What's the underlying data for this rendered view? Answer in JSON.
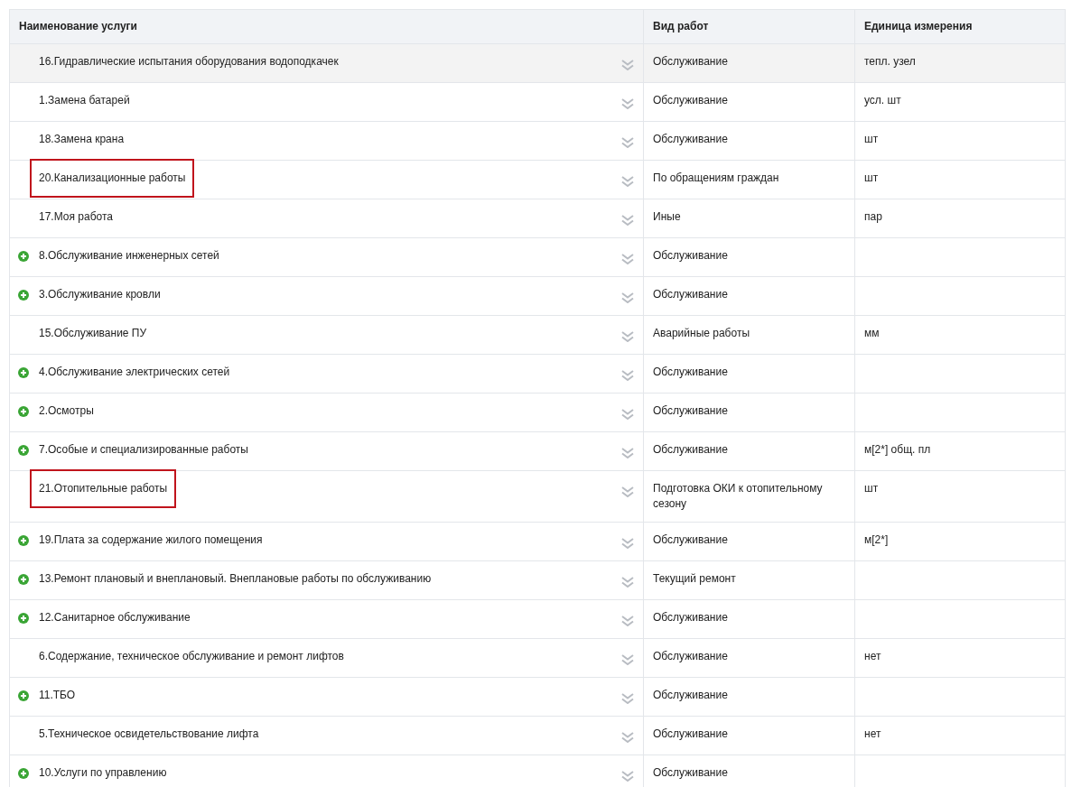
{
  "table": {
    "columns": [
      "Наименование услуги",
      "Вид работ",
      "Единица измерения"
    ],
    "rows": [
      {
        "name": "16.Гидравлические испытания оборудования водоподкачек",
        "work_type": "Обслуживание",
        "unit": "тепл. узел",
        "expandable": false,
        "highlighted": false,
        "selected": true
      },
      {
        "name": "1.Замена батарей",
        "work_type": "Обслуживание",
        "unit": "усл. шт",
        "expandable": false,
        "highlighted": false,
        "selected": false
      },
      {
        "name": "18.Замена крана",
        "work_type": "Обслуживание",
        "unit": "шт",
        "expandable": false,
        "highlighted": false,
        "selected": false
      },
      {
        "name": "20.Канализационные работы",
        "work_type": "По обращениям граждан",
        "unit": "шт",
        "expandable": false,
        "highlighted": true,
        "selected": false
      },
      {
        "name": "17.Моя работа",
        "work_type": "Иные",
        "unit": "пар",
        "expandable": false,
        "highlighted": false,
        "selected": false
      },
      {
        "name": "8.Обслуживание инженерных сетей",
        "work_type": "Обслуживание",
        "expandable": true,
        "highlighted": false,
        "selected": false
      },
      {
        "name": "3.Обслуживание кровли",
        "work_type": "Обслуживание",
        "expandable": true,
        "highlighted": false,
        "selected": false
      },
      {
        "name": "15.Обслуживание ПУ",
        "work_type": "Аварийные работы",
        "unit": "мм",
        "expandable": false,
        "highlighted": false,
        "selected": false
      },
      {
        "name": "4.Обслуживание электрических сетей",
        "work_type": "Обслуживание",
        "expandable": true,
        "highlighted": false,
        "selected": false
      },
      {
        "name": "2.Осмотры",
        "work_type": "Обслуживание",
        "expandable": true,
        "highlighted": false,
        "selected": false
      },
      {
        "name": "7.Особые и специализированные работы",
        "work_type": "Обслуживание",
        "unit": "м[2*] общ. пл",
        "expandable": true,
        "highlighted": false,
        "selected": false
      },
      {
        "name": "21.Отопительные работы",
        "work_type": "Подготовка ОКИ к отопительному сезону",
        "unit": "шт",
        "expandable": false,
        "highlighted": true,
        "selected": false
      },
      {
        "name": "19.Плата за содержание жилого помещения",
        "work_type": "Обслуживание",
        "unit": "м[2*]",
        "expandable": true,
        "highlighted": false,
        "selected": false
      },
      {
        "name": "13.Ремонт плановый и внеплановый. Внеплановые работы по обслуживанию",
        "work_type": "Текущий ремонт",
        "expandable": true,
        "highlighted": false,
        "selected": false
      },
      {
        "name": "12.Санитарное обслуживание",
        "work_type": "Обслуживание",
        "expandable": true,
        "highlighted": false,
        "selected": false
      },
      {
        "name": "6.Содержание, техническое обслуживание и ремонт лифтов",
        "work_type": "Обслуживание",
        "unit": "нет",
        "expandable": false,
        "highlighted": false,
        "selected": false
      },
      {
        "name": "11.ТБО",
        "work_type": "Обслуживание",
        "expandable": true,
        "highlighted": false,
        "selected": false
      },
      {
        "name": "5.Техническое освидетельствование лифта",
        "work_type": "Обслуживание",
        "unit": "нет",
        "expandable": false,
        "highlighted": false,
        "selected": false
      },
      {
        "name": "10.Услуги по управлению",
        "work_type": "Обслуживание",
        "expandable": true,
        "highlighted": false,
        "selected": false
      }
    ]
  }
}
